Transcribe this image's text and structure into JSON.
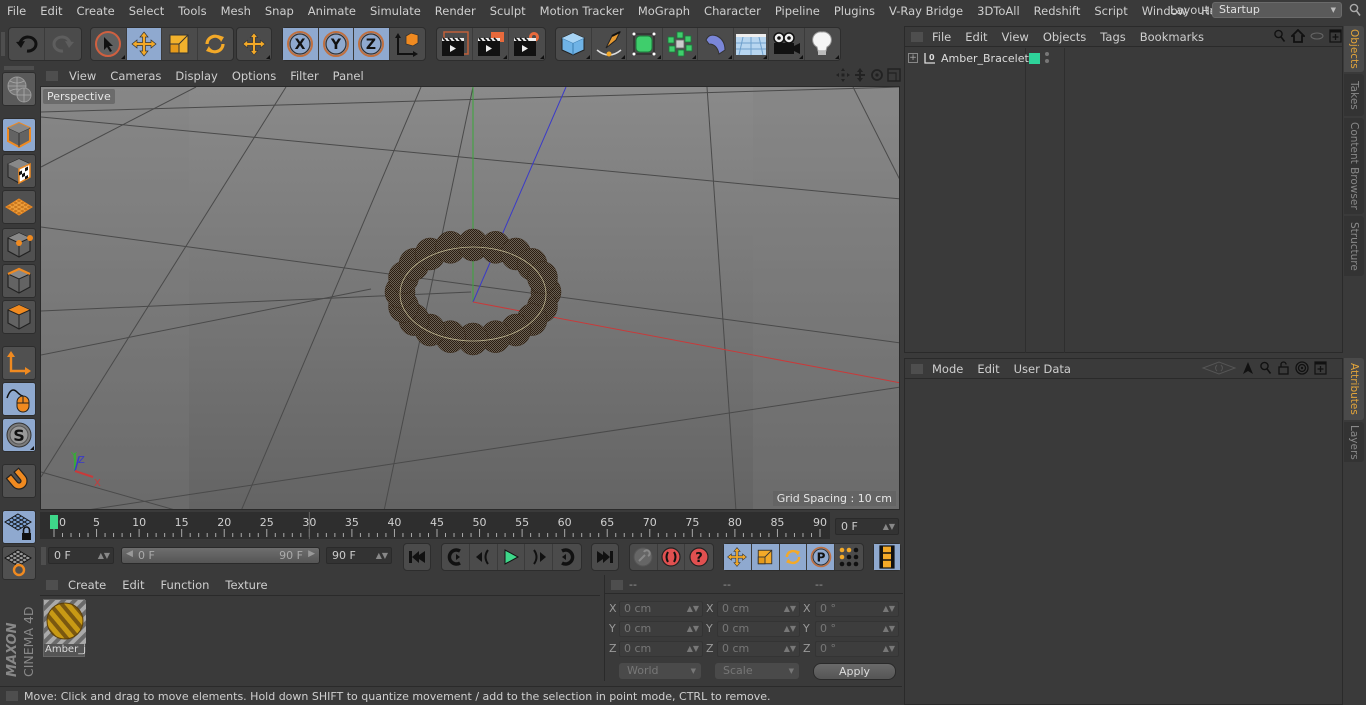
{
  "menubar": {
    "items": [
      "File",
      "Edit",
      "Create",
      "Select",
      "Tools",
      "Mesh",
      "Snap",
      "Animate",
      "Simulate",
      "Render",
      "Sculpt",
      "Motion Tracker",
      "MoGraph",
      "Character",
      "Pipeline",
      "Plugins",
      "V-Ray Bridge",
      "3DToAll",
      "Redshift",
      "Script",
      "Window",
      "Help"
    ],
    "layout_label": "Layout:",
    "layout_value": "Startup"
  },
  "toolbar": {
    "groups": [
      {
        "name": "history",
        "items": [
          {
            "icon": "undo-icon",
            "active": false
          },
          {
            "icon": "redo-icon",
            "active": false
          }
        ]
      },
      {
        "name": "transform",
        "items": [
          {
            "icon": "live-selection-icon",
            "active": false
          },
          {
            "icon": "move-icon",
            "active": true
          },
          {
            "icon": "scale-icon",
            "active": false
          },
          {
            "icon": "rotate-icon",
            "active": false
          }
        ]
      },
      {
        "name": "recent",
        "items": [
          {
            "icon": "recent-move-icon",
            "active": false
          }
        ]
      },
      {
        "name": "axis",
        "items": [
          {
            "icon": "x-axis-lock-icon",
            "active": true
          },
          {
            "icon": "y-axis-lock-icon",
            "active": true
          },
          {
            "icon": "z-axis-lock-icon",
            "active": true
          },
          {
            "icon": "coordinate-system-icon",
            "active": false
          }
        ]
      },
      {
        "name": "render",
        "items": [
          {
            "icon": "render-view-icon"
          },
          {
            "icon": "render-picture-viewer-icon"
          },
          {
            "icon": "render-settings-icon"
          }
        ]
      },
      {
        "name": "create",
        "items": [
          {
            "icon": "cube-icon"
          },
          {
            "icon": "pen-spline-icon"
          },
          {
            "icon": "subdivision-icon"
          },
          {
            "icon": "cloner-icon"
          },
          {
            "icon": "deformer-icon"
          },
          {
            "icon": "floor-icon"
          },
          {
            "icon": "camera-icon"
          },
          {
            "icon": "light-icon"
          }
        ]
      }
    ]
  },
  "lefttools": [
    {
      "icon": "make-editable-icon",
      "active": false
    },
    {
      "icon": "model-mode-icon",
      "active": true
    },
    {
      "icon": "texture-mode-icon",
      "active": false
    },
    {
      "icon": "workplane-mode-icon",
      "active": false
    },
    {
      "icon": "points-mode-icon",
      "active": false
    },
    {
      "icon": "edges-mode-icon",
      "active": false
    },
    {
      "icon": "polygons-mode-icon",
      "active": false
    },
    {
      "icon": "axis-mode-icon",
      "active": false
    },
    {
      "icon": "tweak-mode-icon",
      "active": true
    },
    {
      "icon": "solo-icon",
      "active": true
    },
    {
      "icon": "snap-magnet-icon",
      "active": false
    },
    {
      "icon": "workplane-lock-icon",
      "active": true
    },
    {
      "icon": "workplane-align-icon",
      "active": false
    }
  ],
  "viewport": {
    "menu": [
      "View",
      "Cameras",
      "Display",
      "Options",
      "Filter",
      "Panel"
    ],
    "camera_label": "Perspective",
    "grid_spacing": "Grid Spacing : 10 cm",
    "axis_labels": {
      "x": "X",
      "y": "Y",
      "z": "Z"
    },
    "colors": {
      "x_axis": "#c83a3a",
      "y_axis": "#3aa83a",
      "z_axis": "#3a3ac8"
    }
  },
  "timeline": {
    "ticks": [
      "0",
      "5",
      "10",
      "15",
      "20",
      "25",
      "30",
      "35",
      "40",
      "45",
      "50",
      "55",
      "60",
      "65",
      "70",
      "75",
      "80",
      "85",
      "90"
    ],
    "current_frame_marker": "0",
    "current_frame": "0 F",
    "start_field": "0 F",
    "range_start": "0 F",
    "range_end": "90 F",
    "end_field": "90 F",
    "playhead_color": "#3ed88a"
  },
  "playback": {
    "buttons": [
      "go-to-start-icon",
      "go-to-previous-key-icon",
      "previous-frame-icon",
      "play-forward-icon",
      "next-frame-icon",
      "go-to-next-key-icon",
      "go-to-end-icon"
    ],
    "keyframe_buttons": [
      "record-disabled-icon",
      "record-active-objects-icon",
      "autokeying-icon"
    ],
    "key_type_buttons": [
      "key-position-icon",
      "key-scale-icon",
      "key-rotation-icon",
      "key-parameter-icon",
      "key-pla-icon"
    ],
    "timeline_button": "timeline-window-icon"
  },
  "material_manager": {
    "menu": [
      "Create",
      "Edit",
      "Function",
      "Texture"
    ],
    "materials": [
      {
        "name": "Amber_j"
      }
    ]
  },
  "coordinates": {
    "headers": [
      "--",
      "--",
      "--"
    ],
    "rows": [
      {
        "axis": "X",
        "pos": "0 cm",
        "size": "0 cm",
        "rot": "0 °"
      },
      {
        "axis": "Y",
        "pos": "0 cm",
        "size": "0 cm",
        "rot": "0 °"
      },
      {
        "axis": "Z",
        "pos": "0 cm",
        "size": "0 cm",
        "rot": "0 °"
      }
    ],
    "space_select": "World",
    "mode_select": "Scale",
    "apply_label": "Apply"
  },
  "status": {
    "text": "Move: Click and drag to move elements. Hold down SHIFT to quantize movement / add to the selection in point mode, CTRL to remove."
  },
  "object_manager": {
    "menu": [
      "File",
      "Edit",
      "View",
      "Objects",
      "Tags",
      "Bookmarks"
    ],
    "objects": [
      {
        "name": "Amber_Bracelet",
        "layer_color": "#2ed39a"
      }
    ]
  },
  "attribute_manager": {
    "menu": [
      "Mode",
      "Edit",
      "User Data"
    ]
  },
  "side_tabs": {
    "top": [
      {
        "label": "Objects",
        "active": true
      },
      {
        "label": "Takes",
        "active": false
      },
      {
        "label": "Content Browser",
        "active": false
      },
      {
        "label": "Structure",
        "active": false
      }
    ],
    "bottom": [
      {
        "label": "Attributes",
        "active": true
      },
      {
        "label": "Layers",
        "active": false
      }
    ]
  },
  "brand": {
    "line1": "MAXON",
    "line2": "CINEMA 4D"
  }
}
